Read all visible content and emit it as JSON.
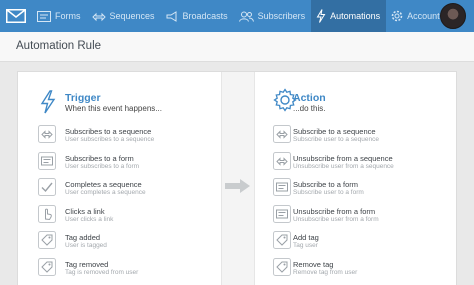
{
  "nav": {
    "items": [
      {
        "label": "Forms",
        "icon": "forms-icon"
      },
      {
        "label": "Sequences",
        "icon": "sequences-icon"
      },
      {
        "label": "Broadcasts",
        "icon": "broadcasts-icon"
      },
      {
        "label": "Subscribers",
        "icon": "subscribers-icon"
      },
      {
        "label": "Automations",
        "icon": "automations-icon",
        "active": true
      },
      {
        "label": "Account",
        "icon": "gear-icon"
      }
    ],
    "help_label": "?"
  },
  "header": {
    "title": "Automation Rule"
  },
  "trigger": {
    "title": "Trigger",
    "subtitle": "When this event happens...",
    "options": [
      {
        "title": "Subscribes to a sequence",
        "desc": "User subscribes to a sequence",
        "icon": "sequence-icon"
      },
      {
        "title": "Subscribes to a form",
        "desc": "User subscribes to a form",
        "icon": "form-icon"
      },
      {
        "title": "Completes a sequence",
        "desc": "User completes a sequence",
        "icon": "check-icon"
      },
      {
        "title": "Clicks a link",
        "desc": "User clicks a link",
        "icon": "pointer-icon"
      },
      {
        "title": "Tag added",
        "desc": "User is tagged",
        "icon": "tag-icon"
      },
      {
        "title": "Tag removed",
        "desc": "Tag is removed from user",
        "icon": "tag-icon"
      }
    ]
  },
  "action": {
    "title": "Action",
    "subtitle": "...do this.",
    "options": [
      {
        "title": "Subscribe to a sequence",
        "desc": "Subscribe user to a sequence",
        "icon": "sequence-icon"
      },
      {
        "title": "Unsubscribe from a sequence",
        "desc": "Unsubscribe user from a sequence",
        "icon": "sequence-icon"
      },
      {
        "title": "Subscribe to a form",
        "desc": "Subscribe user to a form",
        "icon": "form-icon"
      },
      {
        "title": "Unsubscribe from a form",
        "desc": "Unsubscribe user from a form",
        "icon": "form-icon"
      },
      {
        "title": "Add tag",
        "desc": "Tag user",
        "icon": "tag-icon"
      },
      {
        "title": "Remove tag",
        "desc": "Remove tag from user",
        "icon": "tag-icon"
      }
    ]
  },
  "colors": {
    "accent": "#3f88c6",
    "nav_active": "#336fa3",
    "icon_gray": "#a0a5aa"
  }
}
